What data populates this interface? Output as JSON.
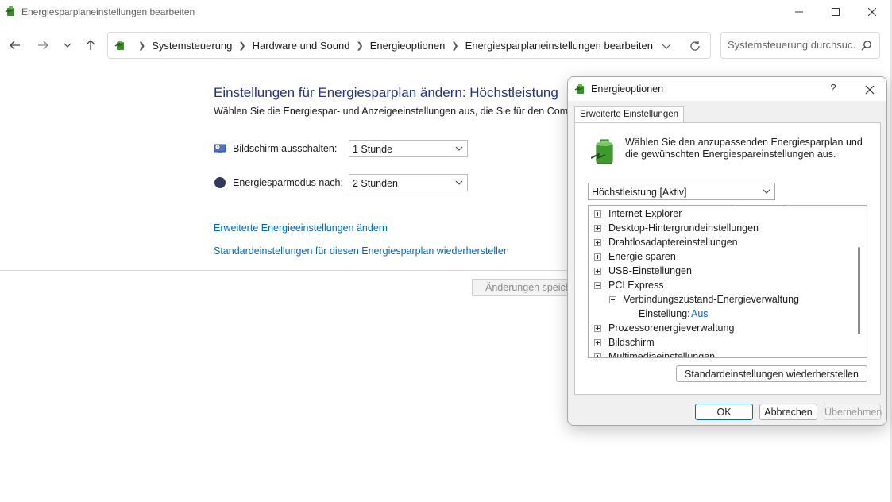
{
  "window": {
    "title": "Energiesparplaneinstellungen bearbeiten",
    "icon": "power-options-icon"
  },
  "navigation": {
    "breadcrumbs": [
      "Systemsteuerung",
      "Hardware und Sound",
      "Energieoptionen",
      "Energiesparplaneinstellungen bearbeiten"
    ],
    "search_placeholder": "Systemsteuerung durchsuc..."
  },
  "main": {
    "heading": "Einstellungen für Energiesparplan ändern: Höchstleistung",
    "subheading": "Wählen Sie die Energiespar- und Anzeigeeinstellungen aus, die Sie für den Computer verwenden möchten.",
    "settings": [
      {
        "label": "Bildschirm ausschalten:",
        "value": "1 Stunde",
        "icon": "monitor-icon"
      },
      {
        "label": "Energiesparmodus nach:",
        "value": "2 Stunden",
        "icon": "moon-icon"
      }
    ],
    "links": [
      "Erweiterte Energieeinstellungen ändern",
      "Standardeinstellungen für diesen Energiesparplan wiederherstellen"
    ],
    "save_button": "Änderungen speichern"
  },
  "dialog": {
    "title": "Energieoptionen",
    "help": "?",
    "tab": "Erweiterte Einstellungen",
    "description": "Wählen Sie den anzupassenden Energiesparplan und die gewünschten Energiespareinstellungen aus.",
    "plan": "Höchstleistung [Aktiv]",
    "tree": [
      {
        "label": "Internet Explorer",
        "level": 0,
        "state": "collapsed"
      },
      {
        "label": "Desktop-Hintergrundeinstellungen",
        "level": 0,
        "state": "collapsed"
      },
      {
        "label": "Drahtlosadaptereinstellungen",
        "level": 0,
        "state": "collapsed"
      },
      {
        "label": "Energie sparen",
        "level": 0,
        "state": "collapsed"
      },
      {
        "label": "USB-Einstellungen",
        "level": 0,
        "state": "collapsed"
      },
      {
        "label": "PCI Express",
        "level": 0,
        "state": "expanded"
      },
      {
        "label": "Verbindungszustand-Energieverwaltung",
        "level": 1,
        "state": "expanded"
      },
      {
        "label": "Einstellung:",
        "level": 2,
        "state": "leaf",
        "value": "Aus"
      },
      {
        "label": "Prozessorenergieverwaltung",
        "level": 0,
        "state": "collapsed"
      },
      {
        "label": "Bildschirm",
        "level": 0,
        "state": "collapsed"
      },
      {
        "label": "Multimediaeinstellungen",
        "level": 0,
        "state": "collapsed"
      }
    ],
    "restore_button": "Standardeinstellungen wiederherstellen",
    "ok_button": "OK",
    "cancel_button": "Abbrechen",
    "apply_button": "Übernehmen"
  }
}
